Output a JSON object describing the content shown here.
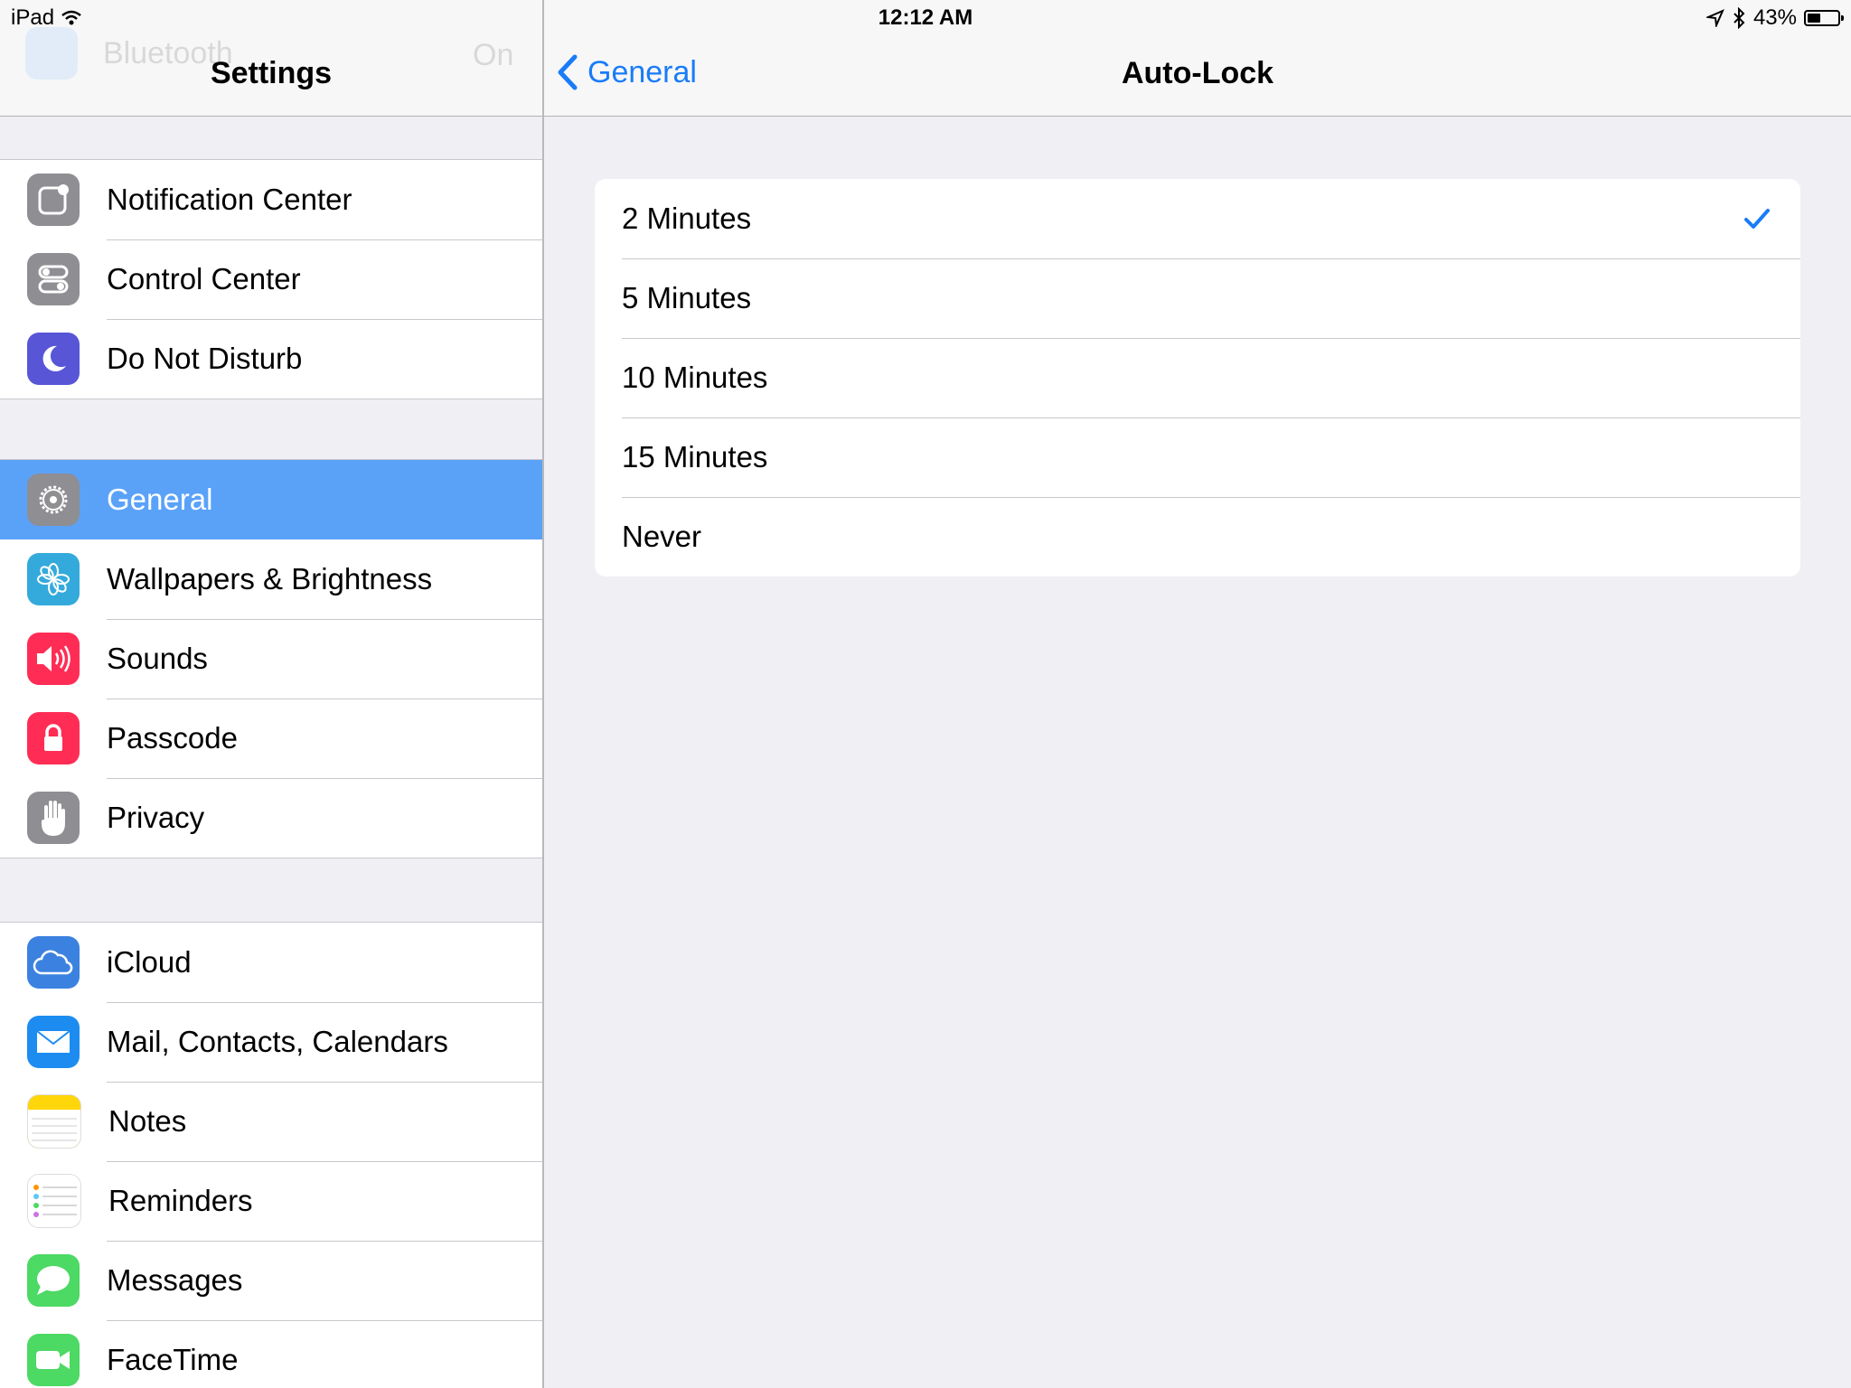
{
  "status": {
    "device": "iPad",
    "time": "12:12 AM",
    "battery_percent": "43%",
    "battery_level": 0.43
  },
  "master": {
    "ghost_item": {
      "label": "Bluetooth",
      "value": "On"
    },
    "title": "Settings",
    "groups": [
      {
        "items": [
          {
            "name": "notification-center",
            "label": "Notification Center",
            "icon": "notification-center-icon",
            "color": "#8e8e93"
          },
          {
            "name": "control-center",
            "label": "Control Center",
            "icon": "control-center-icon",
            "color": "#8e8e93"
          },
          {
            "name": "do-not-disturb",
            "label": "Do Not Disturb",
            "icon": "moon-icon",
            "color": "#5856d6"
          }
        ]
      },
      {
        "items": [
          {
            "name": "general",
            "label": "General",
            "icon": "gear-icon",
            "color": "#8e8e93",
            "selected": true
          },
          {
            "name": "wallpapers",
            "label": "Wallpapers & Brightness",
            "icon": "flower-icon",
            "color": "#34aadc"
          },
          {
            "name": "sounds",
            "label": "Sounds",
            "icon": "speaker-icon",
            "color": "#ff2d55"
          },
          {
            "name": "passcode",
            "label": "Passcode",
            "icon": "lock-icon",
            "color": "#ff2d55"
          },
          {
            "name": "privacy",
            "label": "Privacy",
            "icon": "hand-icon",
            "color": "#8e8e93"
          }
        ]
      },
      {
        "items": [
          {
            "name": "icloud",
            "label": "iCloud",
            "icon": "cloud-icon",
            "color": "#3b82e0"
          },
          {
            "name": "mail",
            "label": "Mail, Contacts, Calendars",
            "icon": "envelope-icon",
            "color": "#1d8cf0"
          },
          {
            "name": "notes",
            "label": "Notes",
            "icon": "notes-icon",
            "color": "#ffd60a"
          },
          {
            "name": "reminders",
            "label": "Reminders",
            "icon": "reminders-icon",
            "color": "#ffffff"
          },
          {
            "name": "messages",
            "label": "Messages",
            "icon": "speech-bubble-icon",
            "color": "#4cd964"
          },
          {
            "name": "facetime",
            "label": "FaceTime",
            "icon": "video-camera-icon",
            "color": "#4cd964"
          }
        ]
      }
    ]
  },
  "detail": {
    "back_label": "General",
    "title": "Auto-Lock",
    "options": [
      {
        "label": "2 Minutes",
        "selected": true
      },
      {
        "label": "5 Minutes"
      },
      {
        "label": "10 Minutes"
      },
      {
        "label": "15 Minutes"
      },
      {
        "label": "Never"
      }
    ],
    "accent_color": "#1a7cf7"
  }
}
